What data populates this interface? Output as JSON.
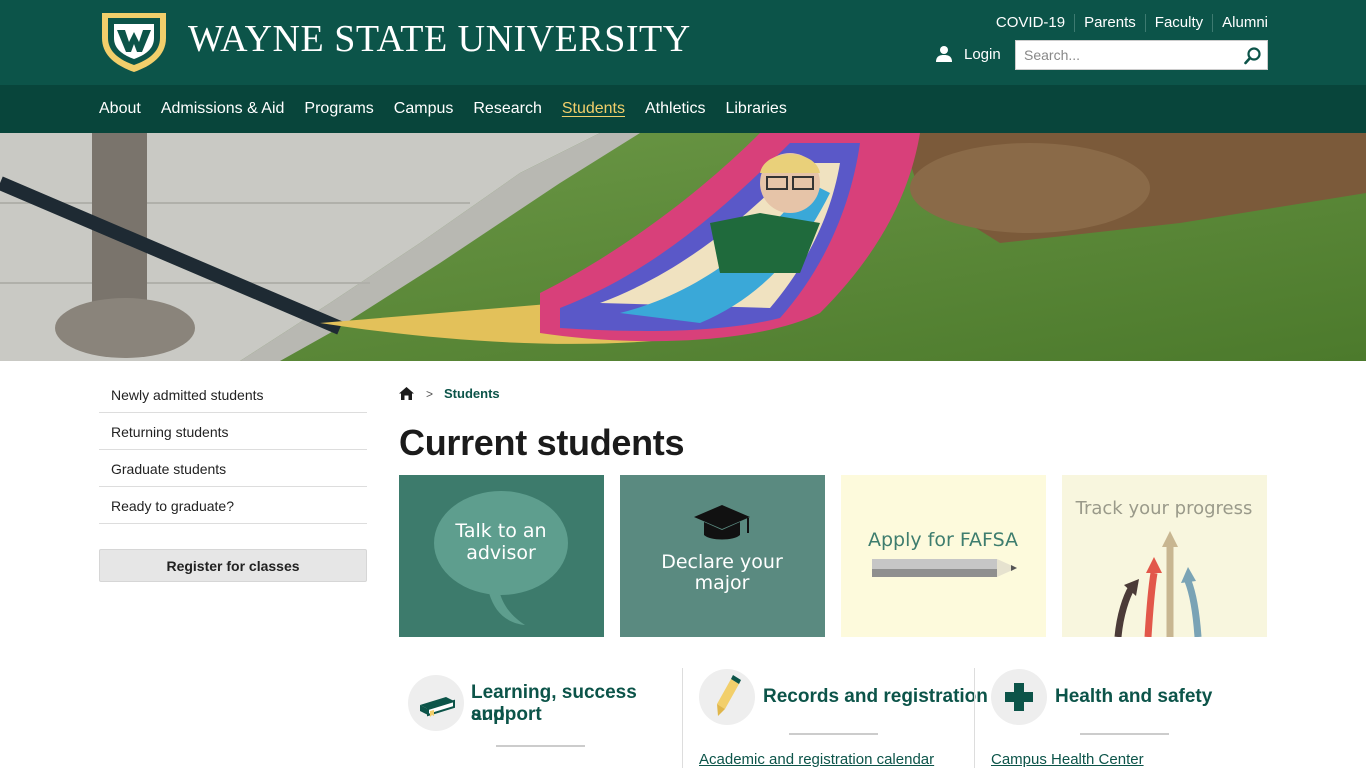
{
  "header": {
    "wordmark": "WAYNE STATE UNIVERSITY",
    "utility_links": [
      "COVID-19",
      "Parents",
      "Faculty",
      "Alumni"
    ],
    "login_label": "Login",
    "search_placeholder": "Search..."
  },
  "nav": {
    "items": [
      "About",
      "Admissions & Aid",
      "Programs",
      "Campus",
      "Research",
      "Students",
      "Athletics",
      "Libraries"
    ],
    "active": "Students"
  },
  "sidebar": {
    "items": [
      "Newly admitted students",
      "Returning students",
      "Graduate students",
      "Ready to graduate?"
    ],
    "register_label": "Register for classes"
  },
  "breadcrumb": {
    "separator": ">",
    "current": "Students"
  },
  "page": {
    "title": "Current students"
  },
  "tiles": {
    "advisor": {
      "line1": "Talk to an",
      "line2": "advisor"
    },
    "major": {
      "line1": "Declare your",
      "line2": "major"
    },
    "fafsa": {
      "text": "Apply for FAFSA"
    },
    "progress": {
      "text": "Track your progress"
    }
  },
  "sections": [
    {
      "title_line1": "Learning, success and",
      "title_line2": "support",
      "icon": "book-icon",
      "link": ""
    },
    {
      "title_line1": "Records and registration",
      "title_line2": "",
      "icon": "pencil-icon",
      "link": "Academic and registration calendar"
    },
    {
      "title_line1": "Health and safety",
      "title_line2": "",
      "icon": "cross-icon",
      "link": "Campus Health Center"
    }
  ],
  "colors": {
    "header_green": "#0c5449",
    "nav_green": "#08453b",
    "active_gold": "#f2cf6b"
  }
}
